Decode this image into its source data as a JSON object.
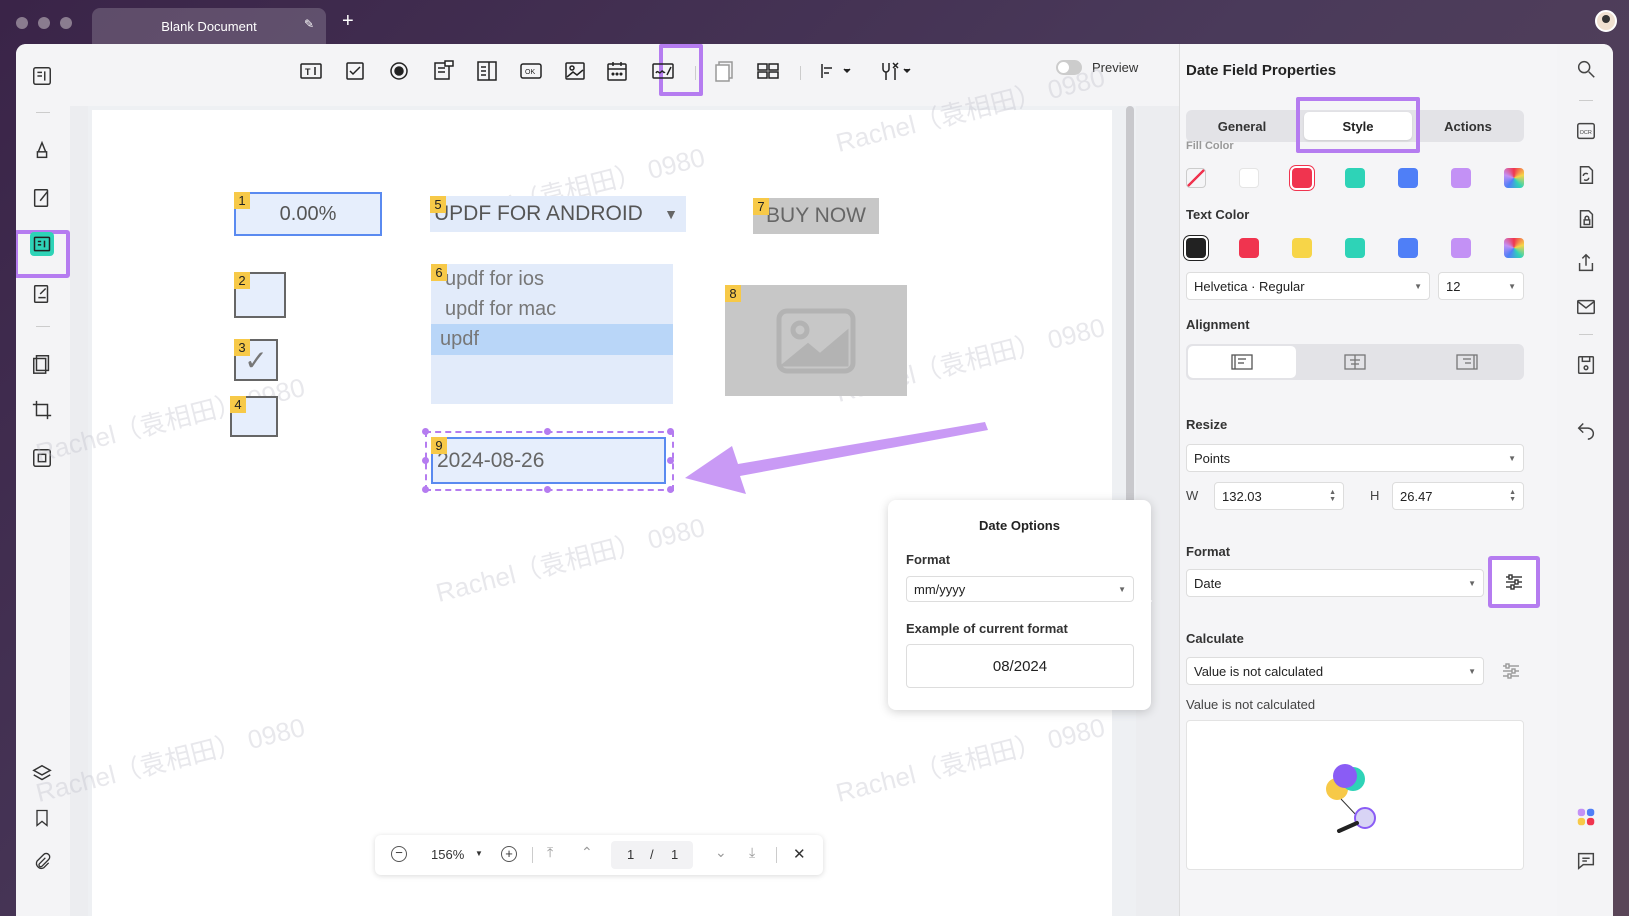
{
  "window": {
    "tab_title": "Blank Document",
    "new_tab": "+",
    "edit_icon": "pencil-icon"
  },
  "toolbar": {
    "tools": [
      "text-field-icon",
      "checkbox-icon",
      "radio-button-icon",
      "combo-box-icon",
      "list-box-icon",
      "push-button-icon",
      "image-field-icon",
      "date-field-icon",
      "signature-field-icon",
      "duplicate-icon",
      "grid-icon",
      "align-icon",
      "tools-icon"
    ],
    "preview_label": "Preview"
  },
  "document": {
    "fields": [
      {
        "id": "1",
        "type": "text",
        "value": "0.00%"
      },
      {
        "id": "2",
        "type": "checkbox",
        "value": ""
      },
      {
        "id": "3",
        "type": "checkbox",
        "value": "✓"
      },
      {
        "id": "4",
        "type": "checkbox",
        "value": ""
      },
      {
        "id": "5",
        "type": "combo",
        "value": "UPDF FOR ANDROID"
      },
      {
        "id": "6",
        "type": "list",
        "items": [
          "updf for ios",
          "updf for mac",
          "updf"
        ]
      },
      {
        "id": "7",
        "type": "button",
        "value": "BUY NOW"
      },
      {
        "id": "8",
        "type": "image",
        "value": ""
      },
      {
        "id": "9",
        "type": "date",
        "value": "2024-08-26"
      }
    ],
    "watermark": "Rachel（袁相田） 0980"
  },
  "popup": {
    "title": "Date Options",
    "format_label": "Format",
    "format_value": "mm/yyyy",
    "example_label": "Example of current format",
    "example_value": "08/2024"
  },
  "panel": {
    "title": "Date Field Properties",
    "tabs": [
      "General",
      "Style",
      "Actions"
    ],
    "active_tab": "Style",
    "fill_color_label": "Fill Color",
    "fill_colors": [
      "none",
      "#ffffff",
      "#f0344f",
      "#2ed3b7",
      "#4f7ff7",
      "#c391f5",
      "rainbow"
    ],
    "text_color_label": "Text Color",
    "text_colors": [
      "#222222",
      "#f0344f",
      "#f7d548",
      "#2ed3b7",
      "#4f7ff7",
      "#c391f5",
      "rainbow"
    ],
    "font_value": "Helvetica · Regular",
    "font_size": "12",
    "alignment_label": "Alignment",
    "resize_label": "Resize",
    "resize_unit": "Points",
    "w_label": "W",
    "w_value": "132.03",
    "h_label": "H",
    "h_value": "26.47",
    "format_label": "Format",
    "format_value": "Date",
    "calculate_label": "Calculate",
    "calculate_value": "Value is not calculated",
    "calculate_note": "Value is not calculated"
  },
  "bottom": {
    "zoom": "156%",
    "page_current": "1",
    "page_sep": "/",
    "page_total": "1"
  },
  "accent_color": "#b57cf0"
}
